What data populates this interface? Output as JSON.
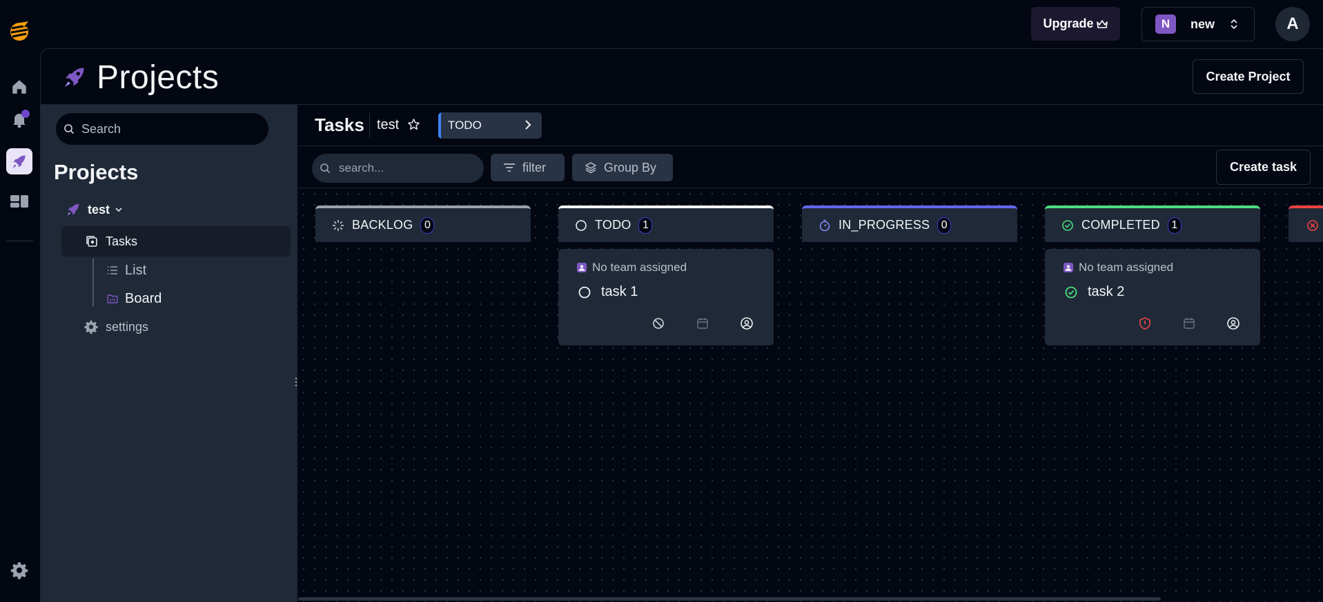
{
  "topbar": {
    "upgrade_label": "Upgrade",
    "workspace_badge": "N",
    "workspace_name": "new",
    "avatar_initial": "A"
  },
  "page": {
    "title": "Projects",
    "create_project_label": "Create Project"
  },
  "sidebar": {
    "search_placeholder": "Search",
    "heading": "Projects",
    "project_name": "test",
    "items": {
      "tasks": "Tasks",
      "list": "List",
      "board": "Board",
      "settings": "settings"
    }
  },
  "tasks_header": {
    "title": "Tasks",
    "project": "test",
    "status_filter": "TODO"
  },
  "toolbar": {
    "search_placeholder": "search...",
    "filter_label": "filter",
    "group_by_label": "Group By",
    "create_task_label": "Create task"
  },
  "columns": [
    {
      "name": "BACKLOG",
      "count": "0",
      "color": "#9ca3af"
    },
    {
      "name": "TODO",
      "count": "1",
      "color": "#f3f4f6"
    },
    {
      "name": "IN_PROGRESS",
      "count": "0",
      "color": "#6366f1"
    },
    {
      "name": "COMPLETED",
      "count": "1",
      "color": "#4ade80"
    },
    {
      "name": "",
      "count": "",
      "color": "#ef4444"
    }
  ],
  "cards": [
    {
      "column": "TODO",
      "team": "No team assigned",
      "title": "task 1"
    },
    {
      "column": "COMPLETED",
      "team": "No team assigned",
      "title": "task 2"
    }
  ],
  "colors": {
    "accent": "#7e57c2",
    "background": "#030712",
    "panel": "#1f2937"
  }
}
